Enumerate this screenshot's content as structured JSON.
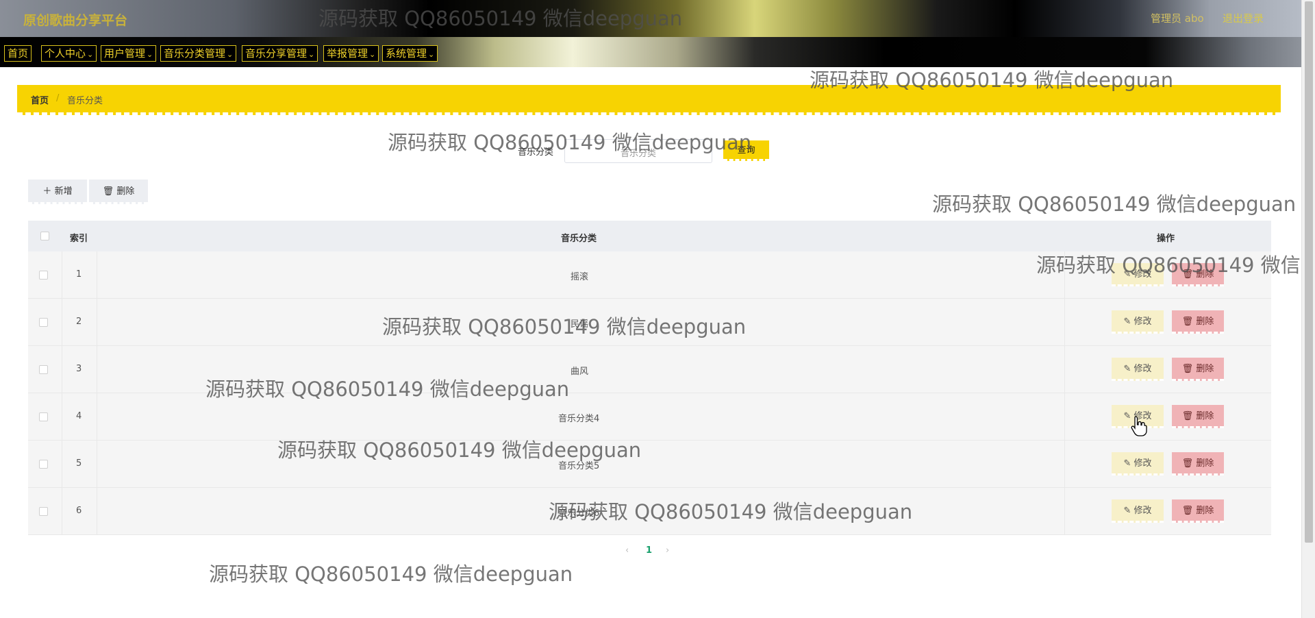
{
  "app": {
    "brand": "原创歌曲分享平台",
    "admin_label": "管理员 abo",
    "logout": "退出登录"
  },
  "nav": [
    {
      "label": "首页",
      "has_dropdown": false
    },
    {
      "label": "个人中心",
      "has_dropdown": true
    },
    {
      "label": "用户管理",
      "has_dropdown": true
    },
    {
      "label": "音乐分类管理",
      "has_dropdown": true
    },
    {
      "label": "音乐分享管理",
      "has_dropdown": true
    },
    {
      "label": "举报管理",
      "has_dropdown": true
    },
    {
      "label": "系统管理",
      "has_dropdown": true
    }
  ],
  "breadcrumb": {
    "home": "首页",
    "separator": "/",
    "current": "音乐分类"
  },
  "search": {
    "label": "音乐分类",
    "placeholder": "音乐分类",
    "button": "查询"
  },
  "toolbar": {
    "add": "新增",
    "delete": "删除"
  },
  "table": {
    "headers": {
      "index": "索引",
      "category": "音乐分类",
      "actions": "操作"
    },
    "rows": [
      {
        "index": "1",
        "category": "摇滚",
        "edit": "修改",
        "delete": "删除"
      },
      {
        "index": "2",
        "category": "民谣",
        "edit": "修改",
        "delete": "删除"
      },
      {
        "index": "3",
        "category": "曲风",
        "edit": "修改",
        "delete": "删除"
      },
      {
        "index": "4",
        "category": "音乐分类4",
        "edit": "修改",
        "delete": "删除"
      },
      {
        "index": "5",
        "category": "音乐分类5",
        "edit": "修改",
        "delete": "删除"
      },
      {
        "index": "6",
        "category": "音乐分类6",
        "edit": "修改",
        "delete": "删除"
      }
    ]
  },
  "pagination": {
    "prev": "‹",
    "current": "1",
    "next": "›"
  },
  "watermark": "源码获取 QQ86050149 微信deepguan",
  "colors": {
    "accent": "#f7d302",
    "danger_bg": "#f0b3b6",
    "edit_bg": "#f7f0c9",
    "nav_text": "#f0d22a"
  },
  "icons": {
    "add": "plus-icon",
    "delete": "trash-icon",
    "edit": "pencil-icon",
    "dropdown": "chevron-down-icon"
  }
}
